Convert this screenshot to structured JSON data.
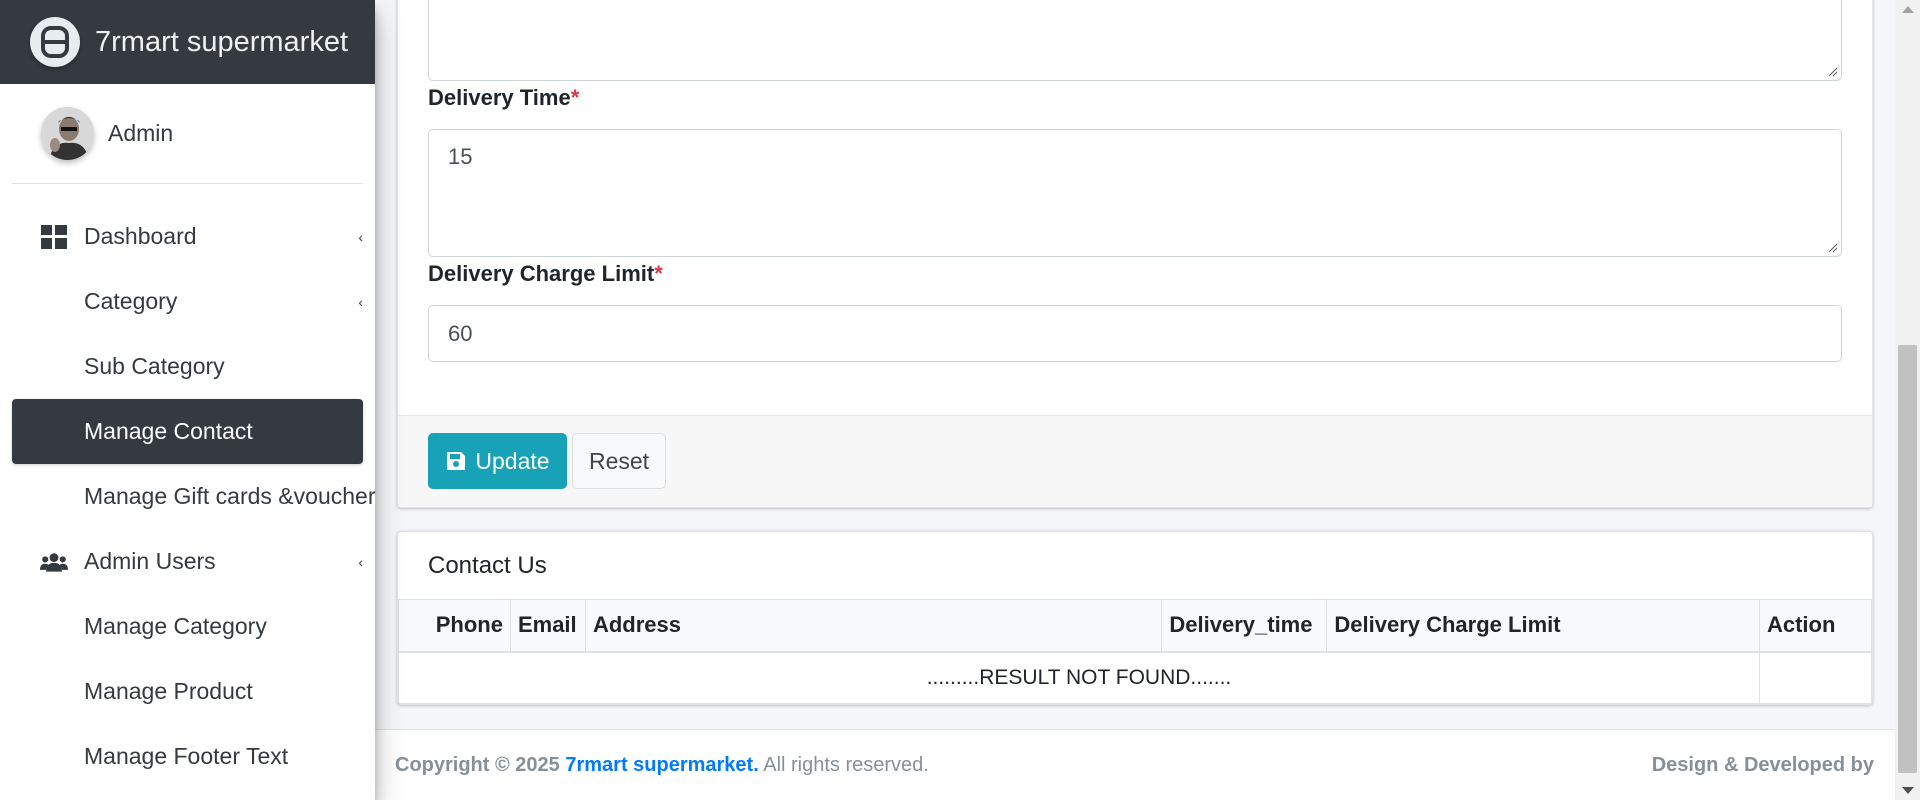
{
  "brand": {
    "name": "7rmart supermarket",
    "logo_icon": "adminlte-logo-icon"
  },
  "user": {
    "name": "Admin"
  },
  "sidebar": {
    "items": [
      {
        "label": "Dashboard",
        "icon": "dashboard-grid-icon",
        "caret": "‹"
      },
      {
        "label": "Category",
        "caret": "‹"
      },
      {
        "label": "Sub Category"
      },
      {
        "label": "Manage Contact",
        "active": true
      },
      {
        "label": "Manage Gift cards &voucher"
      },
      {
        "label": "Admin Users",
        "icon": "users-icon",
        "caret": "‹"
      },
      {
        "label": "Manage Category"
      },
      {
        "label": "Manage Product"
      },
      {
        "label": "Manage Footer Text"
      }
    ]
  },
  "form": {
    "delivery_time": {
      "label": "Delivery Time",
      "required": "*",
      "value": "15"
    },
    "delivery_charge_limit": {
      "label": "Delivery Charge Limit",
      "required": "*",
      "value": "60"
    },
    "update_label": "Update",
    "reset_label": "Reset"
  },
  "contact_list": {
    "title": "Contact Us",
    "columns": [
      "Phone",
      "Email",
      "Address",
      "Delivery_time",
      "Delivery Charge Limit",
      "Action"
    ],
    "empty_message": ".........RESULT NOT FOUND......."
  },
  "footer": {
    "copyright": "Copyright © 2025",
    "brand": "7rmart supermarket.",
    "rights": "All rights reserved.",
    "right_text": "Design & Developed by"
  },
  "colors": {
    "accent": "#17a2b8",
    "sidebar_dark": "#343a40",
    "link": "#007bff",
    "required": "#dc3545"
  }
}
